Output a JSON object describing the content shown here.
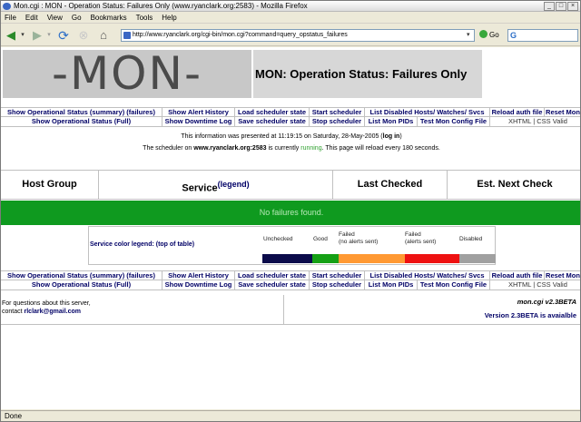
{
  "window": {
    "title": "Mon.cgi : MON - Operation Status: Failures Only (www.ryanclark.org:2583) - Mozilla Firefox",
    "controls": [
      "_",
      "□",
      "×"
    ]
  },
  "menu": [
    "File",
    "Edit",
    "View",
    "Go",
    "Bookmarks",
    "Tools",
    "Help"
  ],
  "toolbar": {
    "url": "http://www.ryanclark.org/cgi-bin/mon.cgi?command=query_opstatus_failures",
    "go_label": "Go",
    "search_value": "G"
  },
  "page": {
    "logo_text": "-MON-",
    "heading": "MON: Operation Status: Failures Only",
    "nav_top": [
      [
        "Show Operational Status (summary) (failures)",
        "Show Alert History",
        "Load scheduler state",
        "Start scheduler",
        "List Disabled Hosts/ Watches/ Svcs",
        "Reload auth file",
        "Reset Mon"
      ],
      [
        "Show Operational Status (Full)",
        "Show Downtime Log",
        "Save scheduler state",
        "Stop scheduler",
        "List Mon PIDs",
        "Test Mon Config File",
        "XHTML | CSS Valid"
      ]
    ],
    "info1_pre": "This information was presented at 11:19:15 on Saturday, 28-May-2005 (",
    "info1_link": "log in",
    "info1_post": ")",
    "info2_pre": "The scheduler on ",
    "info2_host": "www.ryanclark.org:2583",
    "info2_mid": " is currently ",
    "info2_state": "running",
    "info2_post": ". This page will reload every 180 seconds.",
    "table_headers": [
      "Host Group",
      "Service",
      "Last Checked",
      "Est. Next Check"
    ],
    "legend_link": "(legend)",
    "no_failures": "No failures found.",
    "legend_title": "Service color legend: (top of table)",
    "legend_items": [
      {
        "label": "Unchecked",
        "color": "#0b0b4a"
      },
      {
        "label": "Good",
        "color": "#15a015"
      },
      {
        "label": "Failed\n(no alerts sent)",
        "color": "#ff9933"
      },
      {
        "label": "Failed\n(alerts sent)",
        "color": "#ee1111"
      },
      {
        "label": "Disabled",
        "color": "#a0a0a0"
      }
    ],
    "footer_left_line1": "For questions about this server,",
    "footer_left_line2_pre": "contact ",
    "footer_left_email": "rlclark@gmail.com",
    "footer_right_version": "mon.cgi v2.3BETA",
    "footer_right_notice": "Version 2.3BETA is avaialble"
  },
  "statusbar": {
    "text": "Done"
  }
}
